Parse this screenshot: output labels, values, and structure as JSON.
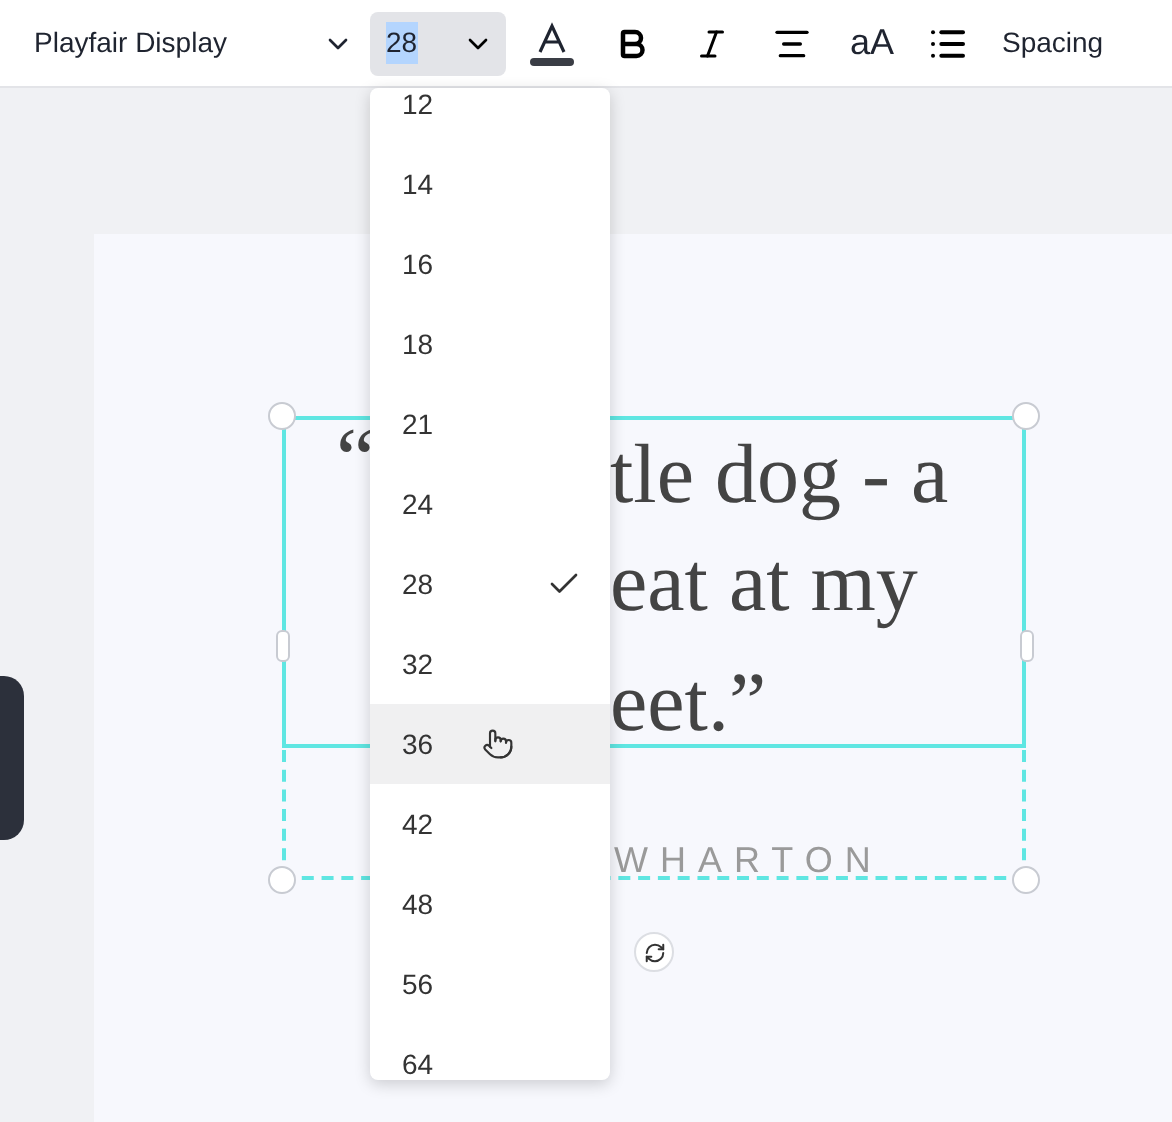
{
  "toolbar": {
    "font_family": "Playfair Display",
    "font_size": {
      "value": "28",
      "value_highlighted": true
    },
    "case_button": "aA",
    "spacing_button": "Spacing"
  },
  "canvas": {
    "quote_fragments": [
      "“",
      "tle dog - a",
      "eat at my",
      "eet.”"
    ],
    "author_fragment": "WHARTON"
  },
  "size_menu": {
    "items": [
      {
        "label": "12",
        "selected": false,
        "hovered": false
      },
      {
        "label": "14",
        "selected": false,
        "hovered": false
      },
      {
        "label": "16",
        "selected": false,
        "hovered": false
      },
      {
        "label": "18",
        "selected": false,
        "hovered": false
      },
      {
        "label": "21",
        "selected": false,
        "hovered": false
      },
      {
        "label": "24",
        "selected": false,
        "hovered": false
      },
      {
        "label": "28",
        "selected": true,
        "hovered": false
      },
      {
        "label": "32",
        "selected": false,
        "hovered": false
      },
      {
        "label": "36",
        "selected": false,
        "hovered": true
      },
      {
        "label": "42",
        "selected": false,
        "hovered": false
      },
      {
        "label": "48",
        "selected": false,
        "hovered": false
      },
      {
        "label": "56",
        "selected": false,
        "hovered": false
      },
      {
        "label": "64",
        "selected": false,
        "hovered": false
      }
    ]
  }
}
